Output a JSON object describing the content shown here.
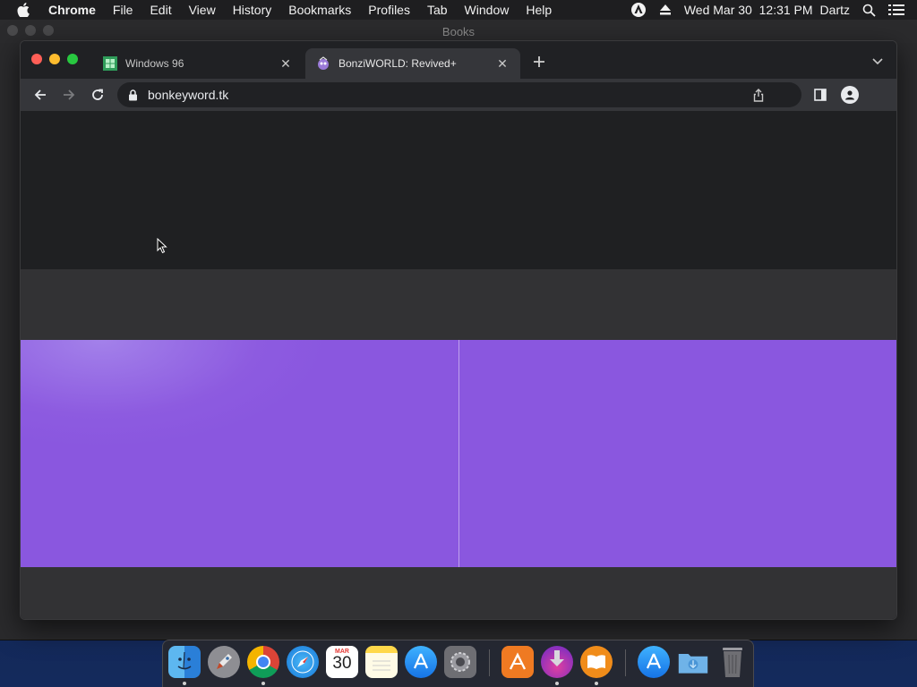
{
  "menubar": {
    "app_name": "Chrome",
    "items": [
      "File",
      "Edit",
      "View",
      "History",
      "Bookmarks",
      "Profiles",
      "Tab",
      "Window",
      "Help"
    ],
    "datetime": "Wed Mar 30  12:31 PM",
    "user": "Dartz"
  },
  "books_window": {
    "title": "Books"
  },
  "browser": {
    "tabs": [
      {
        "title": "Windows 96",
        "favicon": "windows96-icon",
        "active": false
      },
      {
        "title": "BonziWORLD: Revived+",
        "favicon": "bonzi-icon",
        "active": true
      }
    ],
    "url": "bonkeyword.tk"
  },
  "page": {
    "accent_color": "#8d5be0"
  },
  "dock": {
    "calendar_month": "MAR",
    "calendar_day": "30",
    "apps": [
      "finder",
      "launchpad",
      "chrome",
      "safari",
      "calendar",
      "notes",
      "app-store",
      "system-preferences",
      "app-4",
      "app-5",
      "books",
      "app-store-downloads",
      "downloads-folder",
      "trash"
    ]
  },
  "colors": {
    "close": "#ff5f57",
    "minimize": "#febc2e",
    "maximize": "#28c840"
  }
}
